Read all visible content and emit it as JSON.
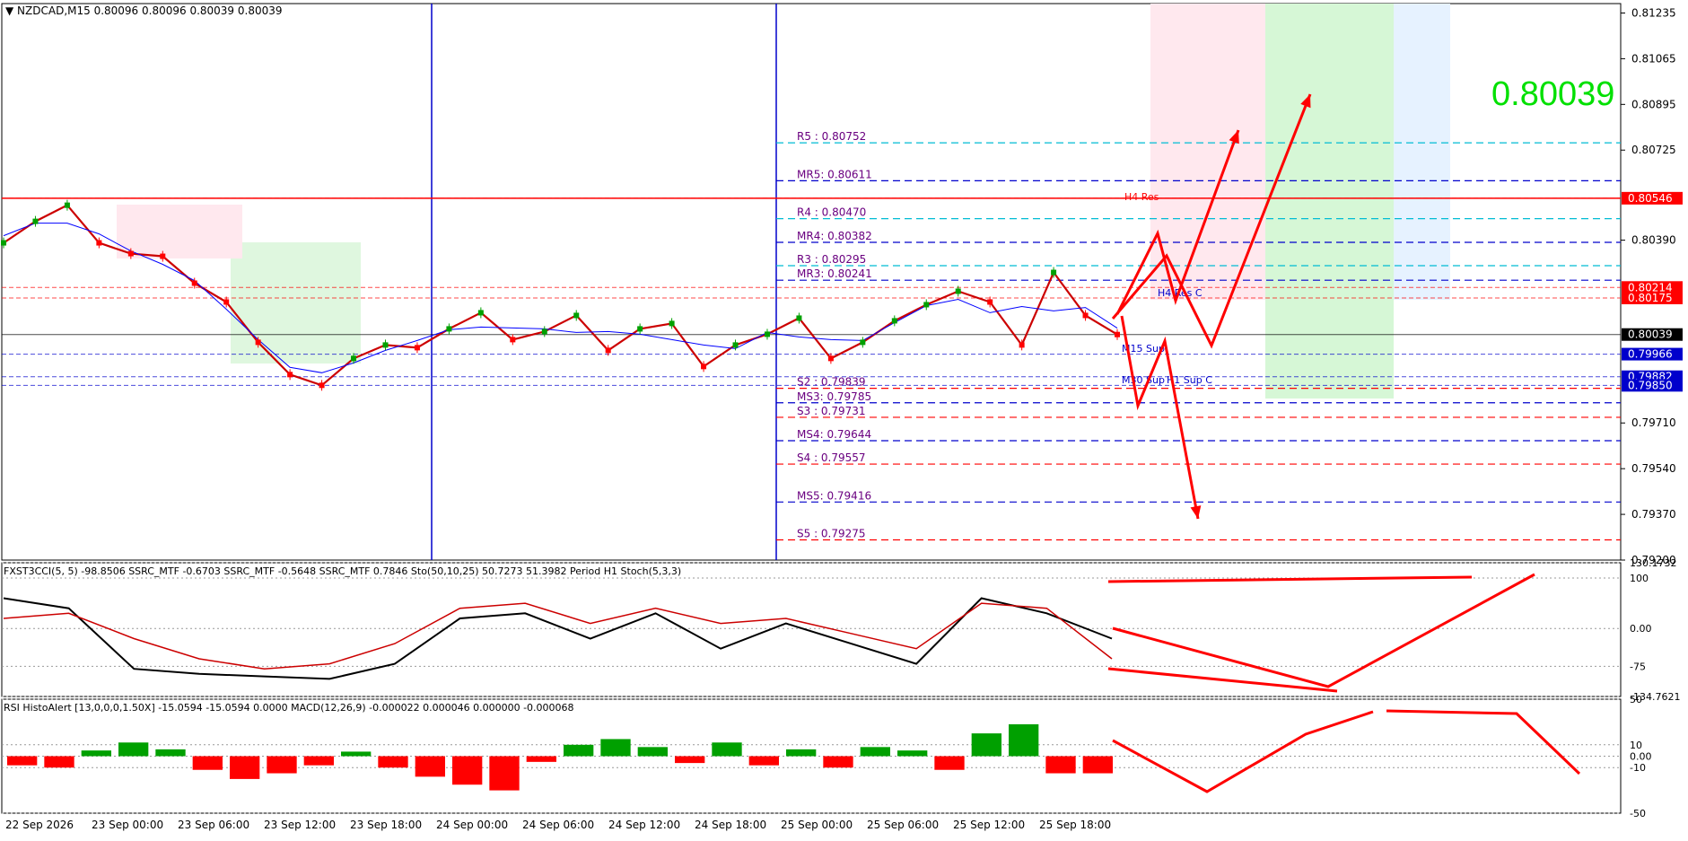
{
  "header": {
    "symbol_line": "NZDCAD,M15  0.80096 0.80096 0.80039 0.80039",
    "osc_line": "FXST3CCI(5, 5) -98.8506  SSRC_MTF -0.6703  SSRC_MTF -0.5648  SSRC_MTF 0.7846  Sto(50,10,25) 50.7273 51.3982  Period H1 Stoch(5,3,3)",
    "macd_line": "RSI HistoAlert [13,0,0,0,1.50X] -15.0594 -15.0594 0.0000  MACD(12,26,9) -0.000022 0.000046 0.000000 -0.000068"
  },
  "current_price_big": "0.80039",
  "colors": {
    "bull": "#00a000",
    "bear": "#ff0000",
    "axis": "#000000",
    "pivot_res": "#00bcd4",
    "pivot_mid": "#0000cc",
    "pivot_sup": "#ff0000",
    "arrow": "#ff0000",
    "big_price": "#00e000"
  },
  "chart_data": [
    {
      "type": "line",
      "title": "NZDCAD,M15",
      "ylim": [
        0.792,
        0.8127
      ],
      "y_ticks": [
        "0.81235",
        "0.81065",
        "0.80895",
        "0.80725",
        "0.80390",
        "0.79710",
        "0.79540",
        "0.79370",
        "0.79200"
      ],
      "x_ticks": [
        "22 Sep 2026",
        "23 Sep 00:00",
        "23 Sep 06:00",
        "23 Sep 12:00",
        "23 Sep 18:00",
        "24 Sep 00:00",
        "24 Sep 06:00",
        "24 Sep 12:00",
        "24 Sep 18:00",
        "25 Sep 00:00",
        "25 Sep 06:00",
        "25 Sep 12:00",
        "25 Sep 18:00"
      ],
      "price_tags": [
        {
          "label": "0.80546",
          "value": 0.80546,
          "color": "#ff0000"
        },
        {
          "label": "0.80214",
          "value": 0.80214,
          "color": "#ff0000"
        },
        {
          "label": "0.80175",
          "value": 0.80175,
          "color": "#ff0000"
        },
        {
          "label": "0.80039",
          "value": 0.80039,
          "color": "#000000"
        },
        {
          "label": "0.79966",
          "value": 0.79966,
          "color": "#0000cc"
        },
        {
          "label": "0.79882",
          "value": 0.79882,
          "color": "#0000cc"
        },
        {
          "label": "0.79850",
          "value": 0.7985,
          "color": "#0000cc"
        }
      ],
      "pivots": [
        {
          "label": "R5 : 0.80752",
          "value": 0.80752,
          "kind": "res"
        },
        {
          "label": "MR5: 0.80611",
          "value": 0.80611,
          "kind": "mid"
        },
        {
          "label": "R4 : 0.80470",
          "value": 0.8047,
          "kind": "res"
        },
        {
          "label": "MR4: 0.80382",
          "value": 0.80382,
          "kind": "mid"
        },
        {
          "label": "R3 : 0.80295",
          "value": 0.80295,
          "kind": "res"
        },
        {
          "label": "MR3: 0.80241",
          "value": 0.80241,
          "kind": "mid"
        },
        {
          "label": "S2 : 0.79839",
          "value": 0.79839,
          "kind": "sup"
        },
        {
          "label": "MS3: 0.79785",
          "value": 0.79785,
          "kind": "mid"
        },
        {
          "label": "S3 : 0.79731",
          "value": 0.79731,
          "kind": "sup"
        },
        {
          "label": "MS4: 0.79644",
          "value": 0.79644,
          "kind": "mid"
        },
        {
          "label": "S4 : 0.79557",
          "value": 0.79557,
          "kind": "sup"
        },
        {
          "label": "MS5: 0.79416",
          "value": 0.79416,
          "kind": "mid"
        },
        {
          "label": "S5 : 0.79275",
          "value": 0.79275,
          "kind": "sup"
        }
      ],
      "annotations": [
        "H4 Res",
        "M15 Sup",
        "M30 Sup",
        "H1 Sup C",
        "H4 Res C"
      ],
      "series": [
        {
          "name": "",
          "x": [
            "22 Sep 2026",
            "23 Sep 00:00",
            "23 Sep 02:00",
            "23 Sep 04:00",
            "23 Sep 06:00",
            "23 Sep 08:00",
            "23 Sep 10:00",
            "23 Sep 12:00",
            "23 Sep 14:00",
            "23 Sep 16:00",
            "23 Sep 18:00",
            "23 Sep 20:00",
            "23 Sep 22:00",
            "24 Sep 00:00",
            "24 Sep 02:00",
            "24 Sep 04:00",
            "24 Sep 06:00",
            "24 Sep 08:00",
            "24 Sep 10:00",
            "24 Sep 12:00",
            "24 Sep 14:00",
            "24 Sep 16:00",
            "24 Sep 18:00",
            "24 Sep 20:00",
            "24 Sep 22:00",
            "25 Sep 00:00",
            "25 Sep 02:00",
            "25 Sep 04:00",
            "25 Sep 06:00",
            "25 Sep 08:00",
            "25 Sep 10:00",
            "25 Sep 12:00",
            "25 Sep 14:00",
            "25 Sep 16:00",
            "25 Sep 18:00",
            "25 Sep 20:00"
          ],
          "values": [
            0.8038,
            0.8046,
            0.8052,
            0.8038,
            0.8034,
            0.8033,
            0.8023,
            0.8016,
            0.8001,
            0.7989,
            0.7985,
            0.7995,
            0.8,
            0.7999,
            0.8006,
            0.8012,
            0.8002,
            0.8005,
            0.8011,
            0.7998,
            0.8006,
            0.8008,
            0.7992,
            0.8,
            0.8004,
            0.801,
            0.7995,
            0.8001,
            0.8009,
            0.8015,
            0.802,
            0.8016,
            0.8,
            0.8027,
            0.8011,
            0.80039
          ]
        }
      ]
    },
    {
      "type": "line",
      "title": "FXST3CCI(5, 5)",
      "ylim": [
        -134.7621,
        130.1732
      ],
      "y_ticks": [
        "130.1732",
        "100",
        "0.00",
        "-75",
        "-134.7621"
      ],
      "series": [
        {
          "name": "",
          "x": [
            1,
            2,
            3,
            4,
            5,
            6,
            7,
            8,
            9,
            10,
            11,
            12,
            13,
            14,
            15,
            16,
            17,
            18
          ],
          "values": [
            60,
            40,
            -80,
            -90,
            -95,
            -100,
            -70,
            20,
            30,
            -20,
            30,
            -40,
            10,
            -30,
            -70,
            60,
            30,
            -20
          ]
        },
        {
          "name": "",
          "x": [
            1,
            2,
            3,
            4,
            5,
            6,
            7,
            8,
            9,
            10,
            11,
            12,
            13,
            14,
            15,
            16,
            17,
            18
          ],
          "values": [
            20,
            30,
            -20,
            -60,
            -80,
            -70,
            -30,
            40,
            50,
            10,
            40,
            10,
            20,
            -10,
            -40,
            50,
            40,
            -60
          ]
        }
      ]
    },
    {
      "type": "bar",
      "title": "RSI HistoAlert",
      "ylim": [
        -50,
        50
      ],
      "y_ticks": [
        "50",
        "10",
        "0.00",
        "-10",
        "-50"
      ],
      "series": [
        {
          "name": "",
          "x": [
            1,
            2,
            3,
            4,
            5,
            6,
            7,
            8,
            9,
            10,
            11,
            12,
            13,
            14,
            15,
            16,
            17,
            18,
            19,
            20,
            21,
            22,
            23,
            24,
            25,
            26,
            27,
            28,
            29,
            30
          ],
          "values": [
            -8,
            -10,
            5,
            12,
            6,
            -12,
            -20,
            -15,
            -8,
            4,
            -10,
            -18,
            -25,
            -30,
            -5,
            10,
            15,
            8,
            -6,
            12,
            -8,
            6,
            -10,
            8,
            5,
            -12,
            20,
            28,
            -15,
            -15
          ]
        }
      ]
    }
  ],
  "forecast_arrows": [
    {
      "points": [
        [
          0.8,
          0
        ],
        [
          0.8043,
          1
        ],
        [
          0.8026,
          2
        ],
        [
          0.80752,
          3
        ]
      ]
    },
    {
      "points": [
        [
          0.801,
          0
        ],
        [
          0.8028,
          1
        ],
        [
          0.7996,
          2
        ],
        [
          0.809,
          3
        ]
      ]
    },
    {
      "points": [
        [
          0.8,
          0
        ],
        [
          0.7972,
          1
        ],
        [
          0.8002,
          2
        ],
        [
          0.7928,
          3
        ]
      ]
    }
  ]
}
